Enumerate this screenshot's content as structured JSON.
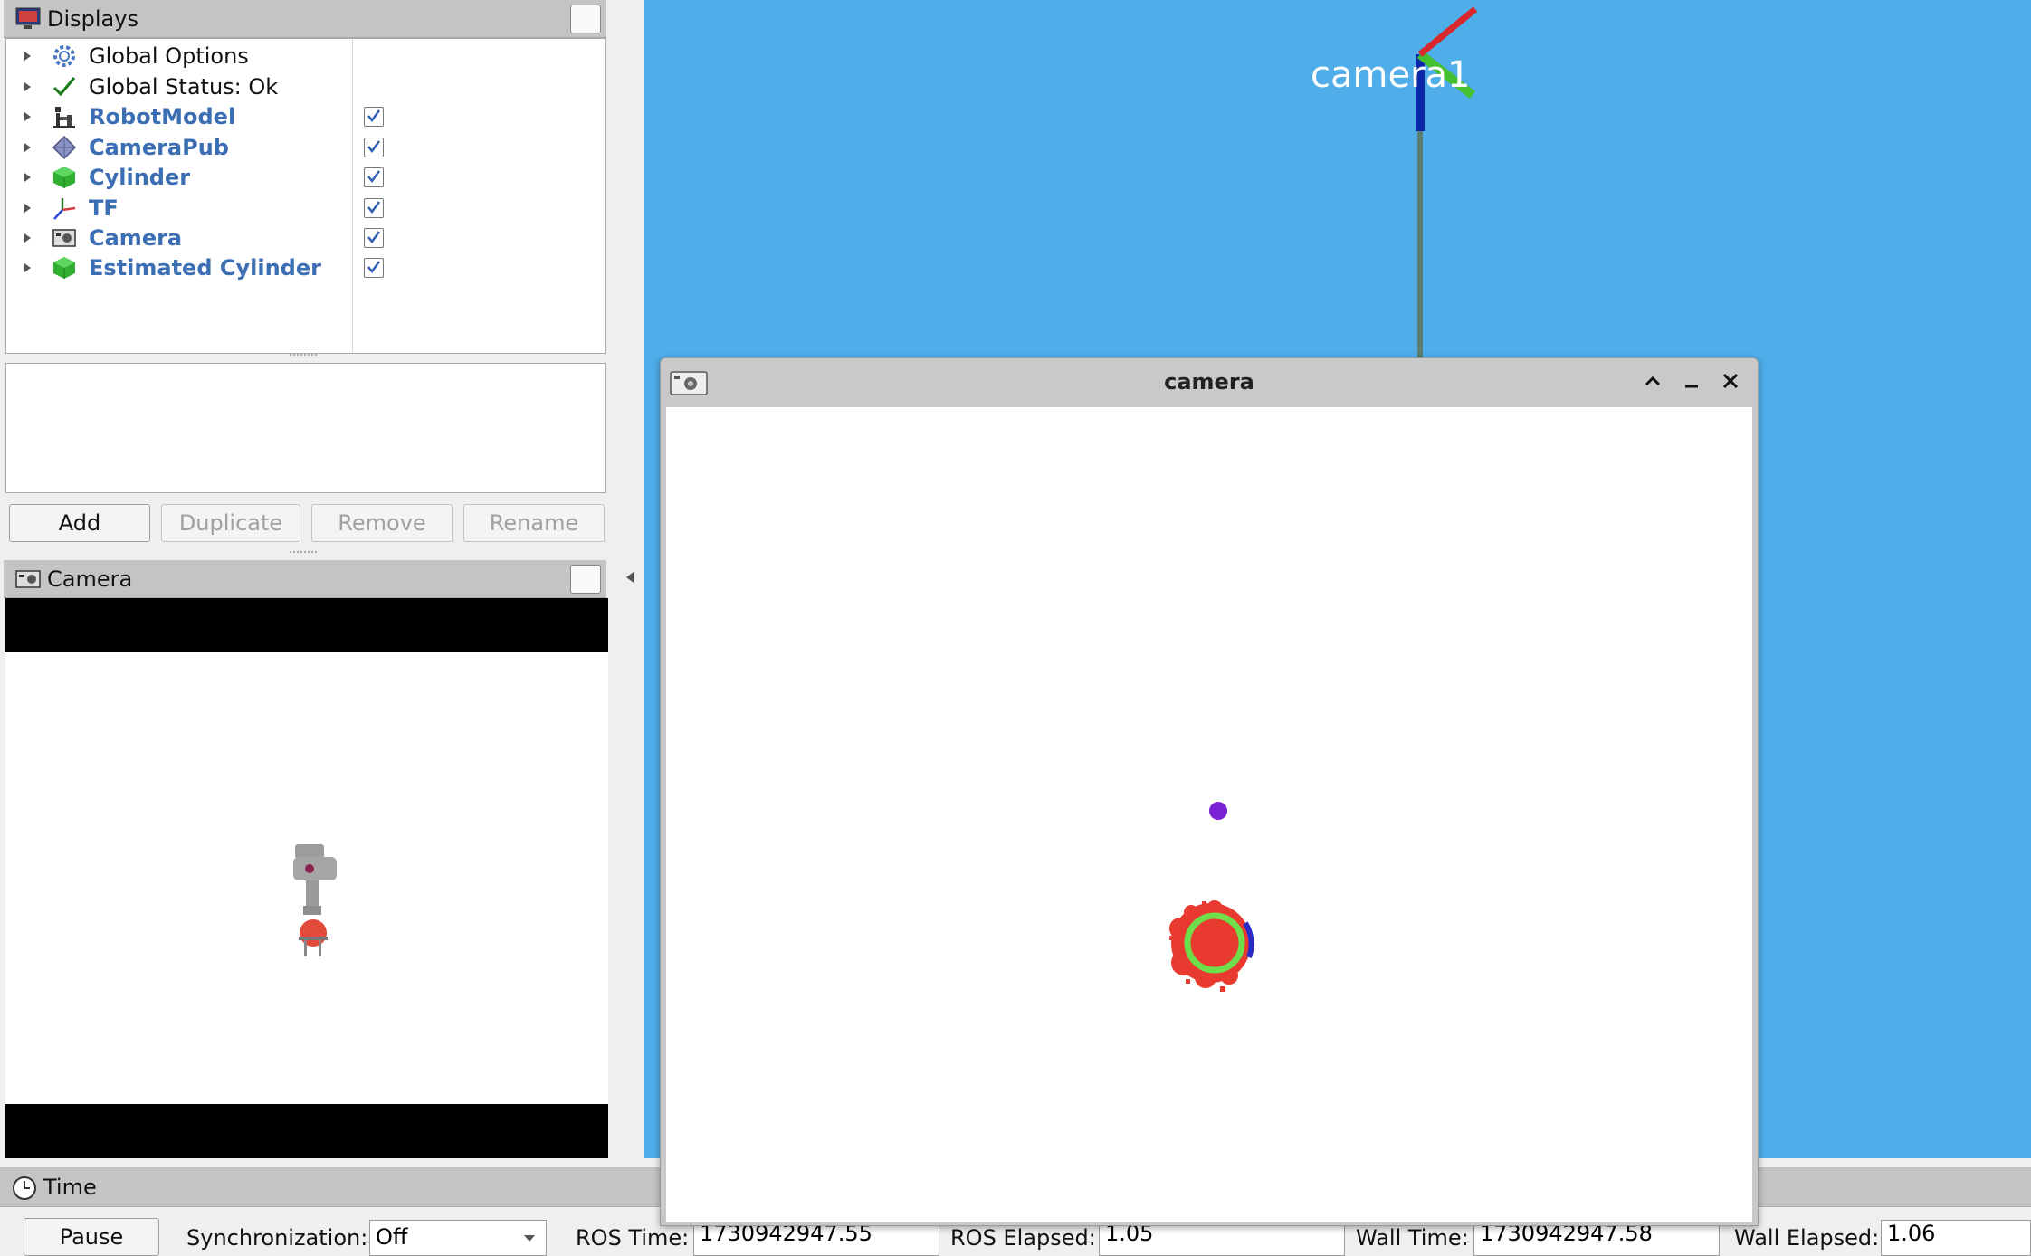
{
  "displays_panel": {
    "title": "Displays",
    "items": [
      {
        "label": "Global Options",
        "icon": "gear-icon",
        "enabled": false
      },
      {
        "label": "Global Status: Ok",
        "icon": "checkmark-icon",
        "enabled": false
      },
      {
        "label": "RobotModel",
        "icon": "robot-icon",
        "enabled": true
      },
      {
        "label": "CameraPub",
        "icon": "diamond-icon",
        "enabled": true
      },
      {
        "label": "Cylinder",
        "icon": "green-cube-icon",
        "enabled": true
      },
      {
        "label": "TF",
        "icon": "axes-icon",
        "enabled": true
      },
      {
        "label": "Camera",
        "icon": "camera-icon",
        "enabled": true
      },
      {
        "label": "Estimated Cylinder",
        "icon": "green-cube-icon",
        "enabled": true
      }
    ],
    "buttons": {
      "add": "Add",
      "duplicate": "Duplicate",
      "remove": "Remove",
      "rename": "Rename"
    }
  },
  "camera_panel": {
    "title": "Camera"
  },
  "viewport": {
    "frame_label": "camera1",
    "background_color": "#4fadea"
  },
  "camera_window": {
    "title": "camera"
  },
  "time_panel": {
    "title": "Time",
    "pause_label": "Pause",
    "sync_label": "Synchronization:",
    "sync_value": "Off",
    "ros_time_label": "ROS Time:",
    "ros_time_value": "1730942947.55",
    "ros_elapsed_label": "ROS Elapsed:",
    "ros_elapsed_value": "1.05",
    "wall_time_label": "Wall Time:",
    "wall_time_value": "1730942947.58",
    "wall_elapsed_label": "Wall Elapsed:",
    "wall_elapsed_value": "1.06"
  },
  "colors": {
    "link_blue": "#3c6eb4",
    "target_red": "#e83a2e",
    "fit_green": "#6ede4a",
    "marker_purple": "#7a22d4"
  }
}
